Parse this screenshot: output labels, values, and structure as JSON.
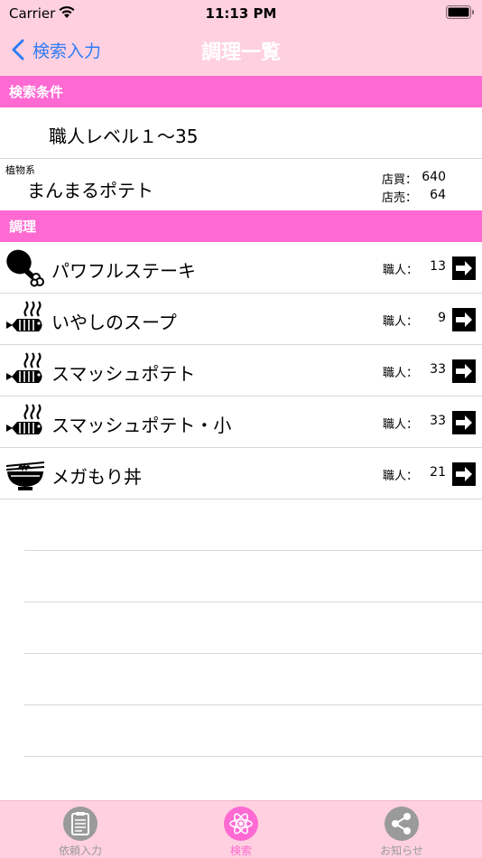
{
  "status_bar": {
    "carrier": "Carrier",
    "time": "11:13 PM"
  },
  "nav": {
    "back_label": "検索入力",
    "title": "調理一覧"
  },
  "search_conditions": {
    "header": "検索条件",
    "level_range": "職人レベル１〜35",
    "item": {
      "category": "植物系",
      "name": "まんまるポテト",
      "buy_label": "店買：",
      "buy_value": "640",
      "sell_label": "店売：",
      "sell_value": "64"
    }
  },
  "recipes": {
    "header": "調理",
    "skill_label": "職人：",
    "items": [
      {
        "icon": "chicken-leg-icon",
        "name": "パワフルステーキ",
        "skill": "13"
      },
      {
        "icon": "cooked-fish-icon",
        "name": "いやしのスープ",
        "skill": "9"
      },
      {
        "icon": "cooked-fish-icon",
        "name": "スマッシュポテト",
        "skill": "33"
      },
      {
        "icon": "cooked-fish-icon",
        "name": "スマッシュポテト・小",
        "skill": "33"
      },
      {
        "icon": "noodle-bowl-icon",
        "name": "メガもり丼",
        "skill": "21"
      }
    ]
  },
  "tabs": [
    {
      "label": "依頼入力",
      "icon": "clipboard-icon",
      "active": false
    },
    {
      "label": "検索",
      "icon": "atom-icon",
      "active": true
    },
    {
      "label": "お知らせ",
      "icon": "share-icon",
      "active": false
    }
  ],
  "colors": {
    "nav_background": "#ffd1e0",
    "section_header": "#ff69d2",
    "back_link": "#2f7cf6",
    "tab_active": "#ff69d2",
    "tab_inactive": "#9a9a9a"
  }
}
